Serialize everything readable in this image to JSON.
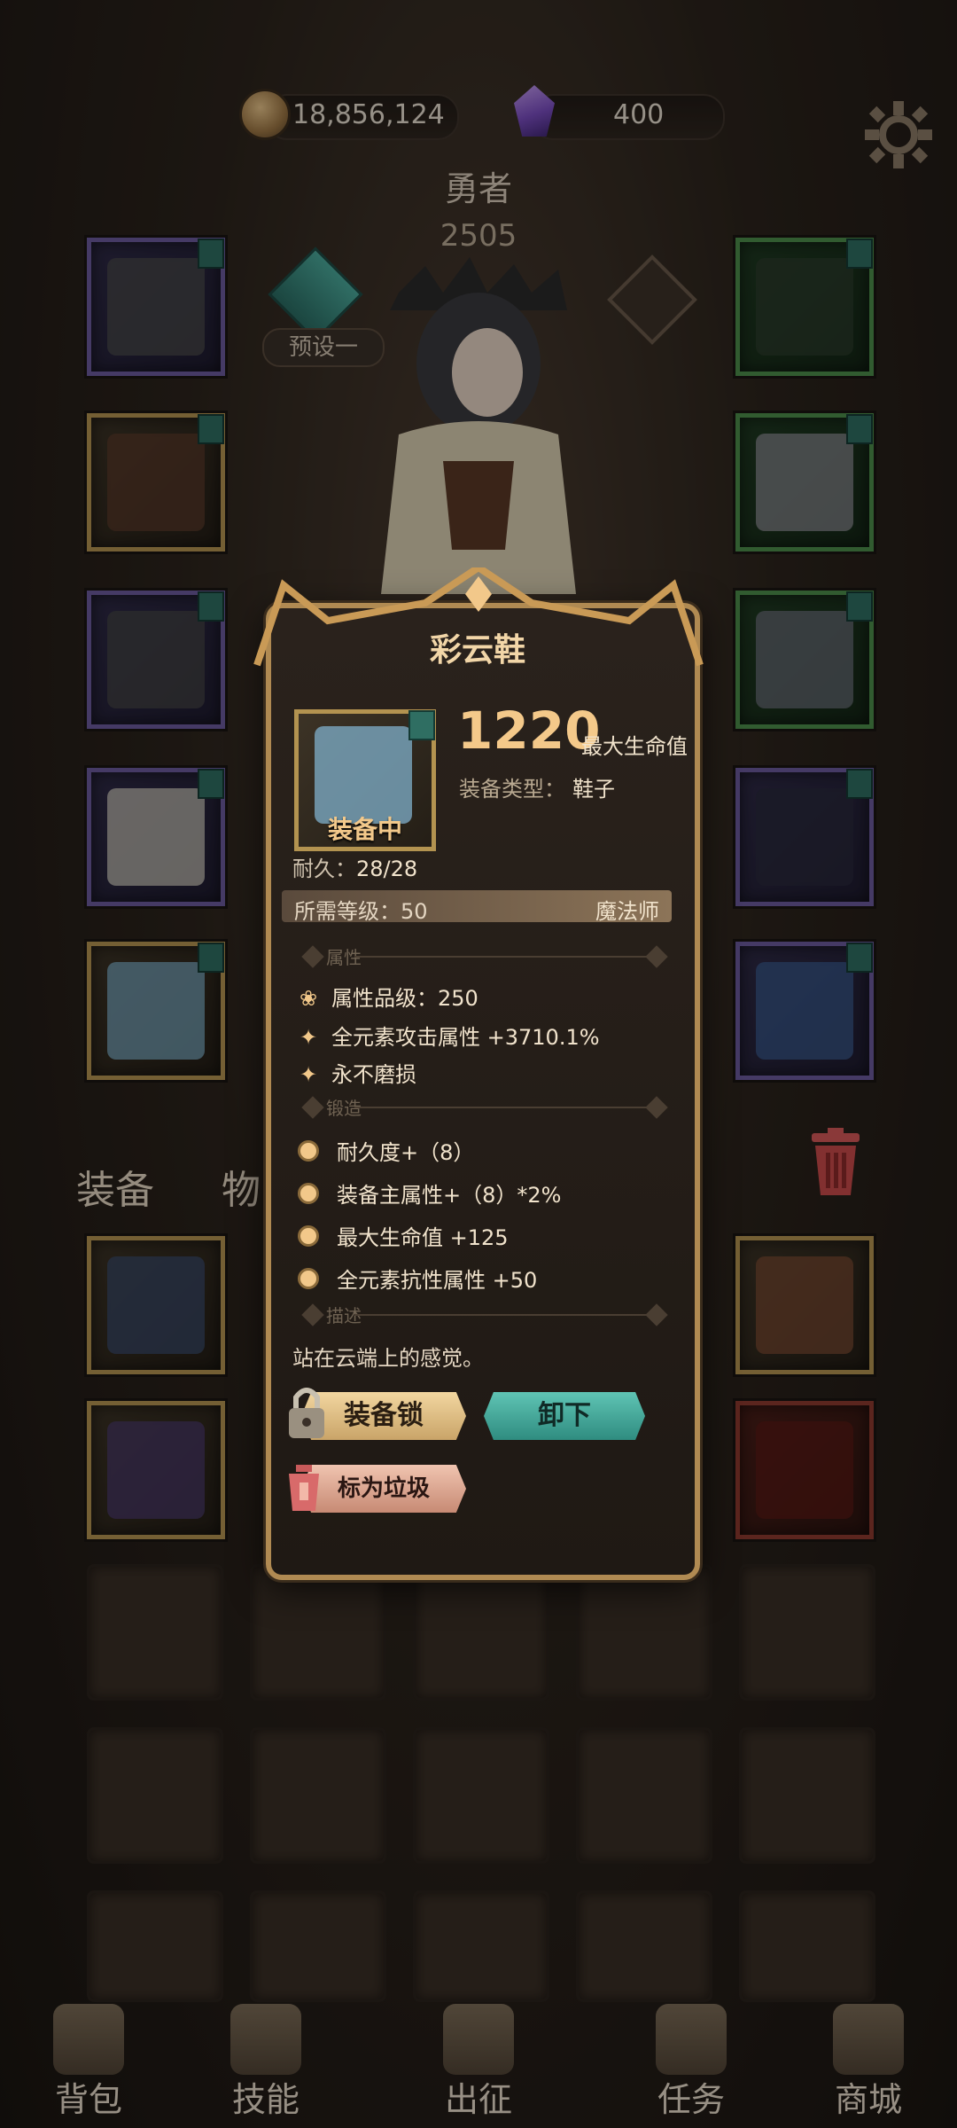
{
  "currency": {
    "gold": "18,856,124",
    "gems": "400"
  },
  "hero": {
    "name": "勇者",
    "power": "2505",
    "preset_label": "预设一"
  },
  "tabs": {
    "equipment": "装备",
    "items": "物品"
  },
  "tooltip": {
    "title": "彩云鞋",
    "value": "1220",
    "value_label": "最大生命值",
    "type_label": "装备类型：",
    "type_value": "鞋子",
    "equipped": "装备中",
    "durability_label": "耐久：",
    "durability_value": "28/28",
    "req_level": "所需等级：50",
    "req_class": "魔法师",
    "section_attr": "属性",
    "attr_grade": "属性品级：250",
    "attr_elem": "全元素攻击属性 +3710.1%",
    "attr_unbreak": "永不磨损",
    "section_forge": "锻造",
    "forge": [
      "耐久度+（8）",
      "装备主属性+（8）*2%",
      "最大生命值 +125",
      "全元素抗性属性 +50"
    ],
    "section_desc": "描述",
    "description": "站在云端上的感觉。",
    "btn_lock": "装备锁",
    "btn_unequip": "卸下",
    "btn_junk": "标为垃圾"
  },
  "nav": [
    "背包",
    "技能",
    "出征",
    "任务",
    "商城"
  ],
  "icons": {
    "gold": "coin-icon",
    "gem": "gem-icon",
    "settings": "gear-icon",
    "trash": "trash-icon",
    "lock": "lock-icon",
    "junk": "lantern-icon"
  },
  "colors": {
    "accent": "#f2c88a",
    "panel_border": "#b08a52",
    "unequip": "#2f8c80"
  }
}
